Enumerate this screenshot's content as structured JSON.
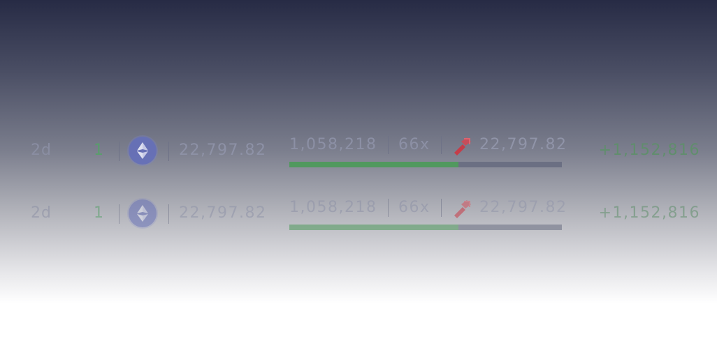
{
  "positions": [
    {
      "age": "2d",
      "quantity": "1",
      "token_icon": "ethereum-icon",
      "entry_price": "22,797.82",
      "size": "1,058,218",
      "leverage": "66x",
      "liquidation_icon": "liquidation-icon",
      "liquidation_price": "22,797.82",
      "margin_ratio": 0.62,
      "pnl": "+1,152,816"
    },
    {
      "age": "2d",
      "quantity": "1",
      "token_icon": "ethereum-icon",
      "entry_price": "22,797.82",
      "size": "1,058,218",
      "leverage": "66x",
      "liquidation_icon": "liquidation-icon",
      "liquidation_price": "22,797.82",
      "margin_ratio": 0.62,
      "pnl": "+1,152,816"
    }
  ],
  "colors": {
    "positive": "#4f9a5c",
    "bar_track": "#6a6e82",
    "token": "#6670b8",
    "liquidation": "#e0424c"
  }
}
